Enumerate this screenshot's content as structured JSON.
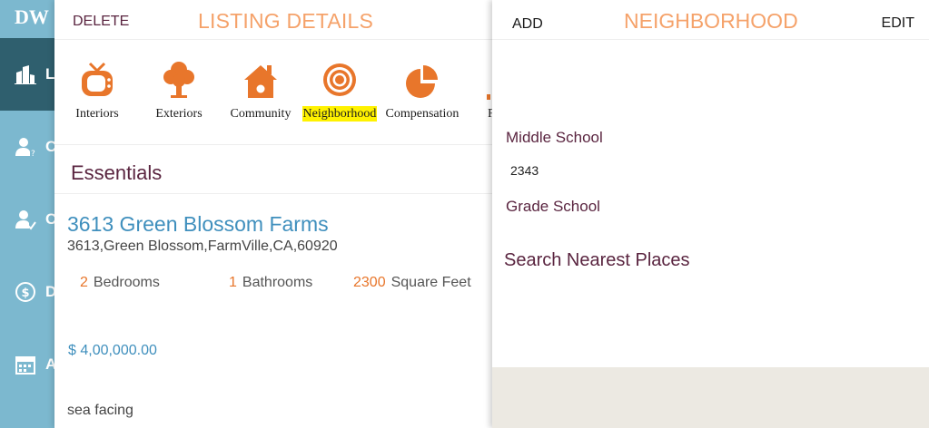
{
  "sidebar": {
    "logo": "DW",
    "items": [
      {
        "icon": "building-icon",
        "letter": "L",
        "active": true
      },
      {
        "icon": "user-question-icon",
        "letter": "C",
        "active": false
      },
      {
        "icon": "user-check-icon",
        "letter": "C",
        "active": false
      },
      {
        "icon": "money-bag-icon",
        "letter": "D",
        "active": false
      },
      {
        "icon": "calendar-icon",
        "letter": "A",
        "active": false
      }
    ]
  },
  "listing": {
    "delete_label": "DELETE",
    "title": "LISTING DETAILS",
    "tabs": [
      {
        "label": "Interiors",
        "icon": "tv-icon"
      },
      {
        "label": "Exteriors",
        "icon": "tree-icon"
      },
      {
        "label": "Community",
        "icon": "house-icon"
      },
      {
        "label": "Neighborhood",
        "icon": "target-icon",
        "selected": true
      },
      {
        "label": "Compensation",
        "icon": "pie-chart-icon"
      },
      {
        "label": "F",
        "icon": "partial-icon"
      }
    ],
    "section_title": "Essentials",
    "property": {
      "name": "3613 Green Blossom Farms",
      "address": "3613,Green Blossom,FarmVille,CA,60920"
    },
    "stats": [
      {
        "value": "2",
        "label": "Bedrooms"
      },
      {
        "value": "1",
        "label": "Bathrooms"
      },
      {
        "value": "2300",
        "label": "Square Feet"
      }
    ],
    "price": "$ 4,00,000.00",
    "description": "sea facing"
  },
  "neighborhood": {
    "add_label": "ADD",
    "title": "NEIGHBORHOOD",
    "edit_label": "EDIT",
    "middle_school_label": "Middle School",
    "middle_school_value": "2343",
    "grade_school_label": "Grade School",
    "search_label": "Search Nearest Places"
  },
  "colors": {
    "accent_orange": "#e8762b",
    "title_orange": "#f5a26a",
    "plum": "#5a2540",
    "link_blue": "#3f8fbd",
    "sidebar_blue": "#7cb8cf",
    "sidebar_active": "#2f5f6e",
    "highlight": "#fff200"
  }
}
